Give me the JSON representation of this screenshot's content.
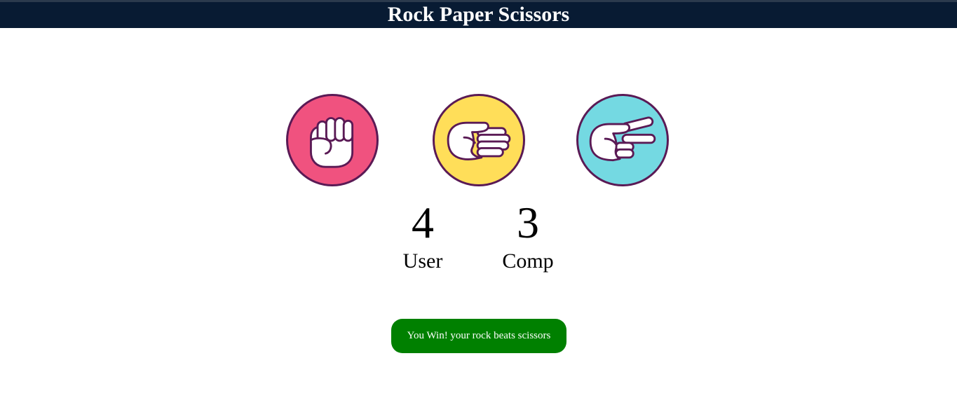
{
  "header": {
    "title": "Rock Paper Scissors"
  },
  "choices": [
    {
      "name": "rock",
      "color": "#f0527f"
    },
    {
      "name": "paper",
      "color": "#ffde59"
    },
    {
      "name": "scissors",
      "color": "#74d9e2"
    }
  ],
  "scores": {
    "user": {
      "value": "4",
      "label": "User"
    },
    "comp": {
      "value": "3",
      "label": "Comp"
    }
  },
  "result": {
    "message": "You Win! your rock beats scissors",
    "color": "#008000"
  },
  "colors": {
    "header_bg": "#081b33",
    "outline": "#5a1a55"
  }
}
